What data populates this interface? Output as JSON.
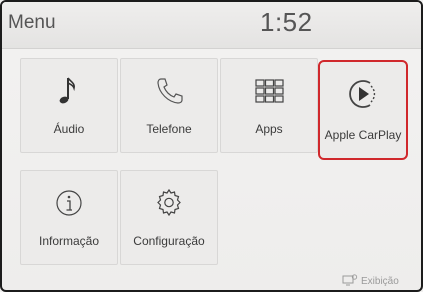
{
  "header": {
    "title": "Menu",
    "time": "1:52"
  },
  "tiles": [
    {
      "label": "Áudio",
      "icon": "music-note-icon"
    },
    {
      "label": "Telefone",
      "icon": "phone-icon"
    },
    {
      "label": "Apps",
      "icon": "apps-grid-icon"
    },
    {
      "label": "Apple CarPlay",
      "icon": "carplay-icon",
      "selected": true
    },
    {
      "label": "Informação",
      "icon": "info-icon"
    },
    {
      "label": "Configuração",
      "icon": "gear-icon"
    }
  ],
  "footer": {
    "display_label": "Exibição",
    "icon": "display-settings-icon"
  },
  "colors": {
    "selection": "#d0282c",
    "background": "#f1f0ef",
    "text": "#3b3b3b"
  }
}
